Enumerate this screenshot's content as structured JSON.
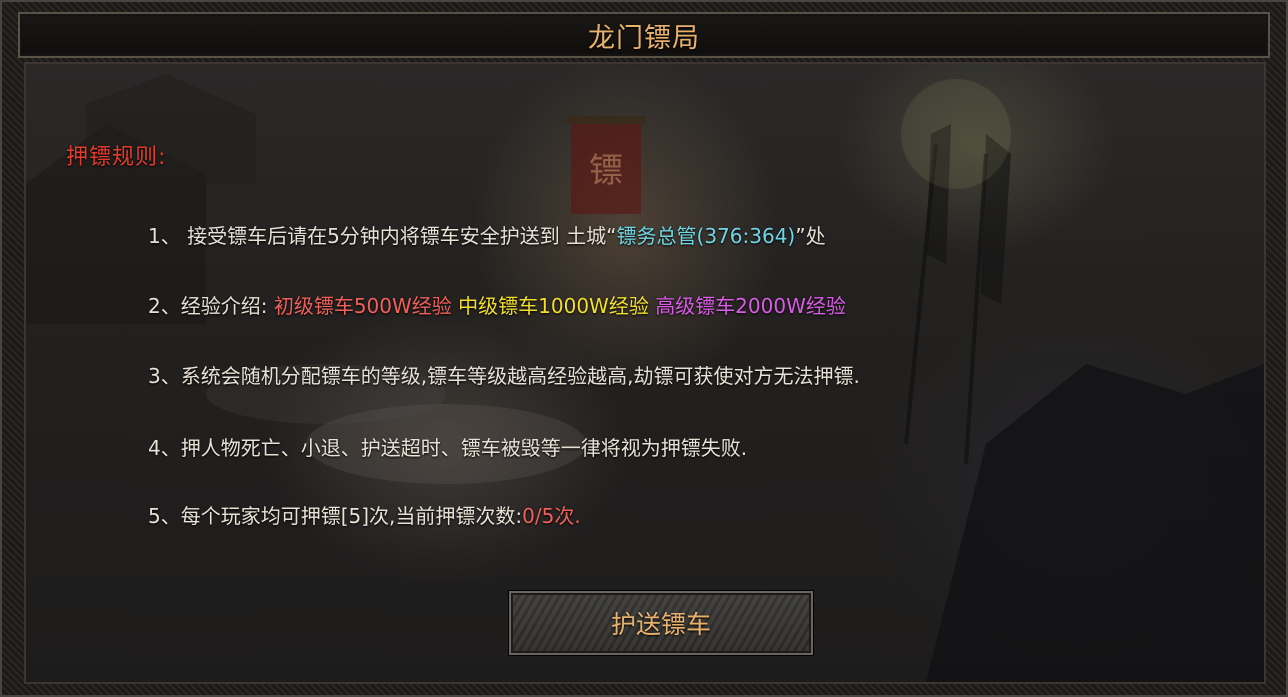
{
  "window": {
    "title": "龙门镖局"
  },
  "rules": {
    "heading": "押镖规则:",
    "item1": {
      "prefix": "1、 接受镖车后请在5分钟内将镖车安全护送到 土城“",
      "npc": "镖务总管(376:364)",
      "suffix": "”处"
    },
    "item2": {
      "prefix": "2、经验介绍:",
      "tier1": "初级镖车500W经验",
      "tier2": "中级镖车1000W经验",
      "tier3": "高级镖车2000W经验"
    },
    "item3": "3、系统会随机分配镖车的等级,镖车等级越高经验越高,劫镖可获使对方无法押镖.",
    "item4": "4、押人物死亡、小退、护送超时、镖车被毁等一律将视为押镖失败.",
    "item5": {
      "prefix": "5、每个玩家均可押镖[5]次,当前押镖次数:",
      "count": "0/5次."
    }
  },
  "actions": {
    "escort_button": "护送镖车"
  },
  "colors": {
    "title": "#e9b26c",
    "heading": "#e23b2c",
    "npc": "#6fd6e6",
    "tier1": "#f0605a",
    "tier2": "#f3df2a",
    "tier3": "#d85ce6",
    "count": "#f0605a"
  }
}
